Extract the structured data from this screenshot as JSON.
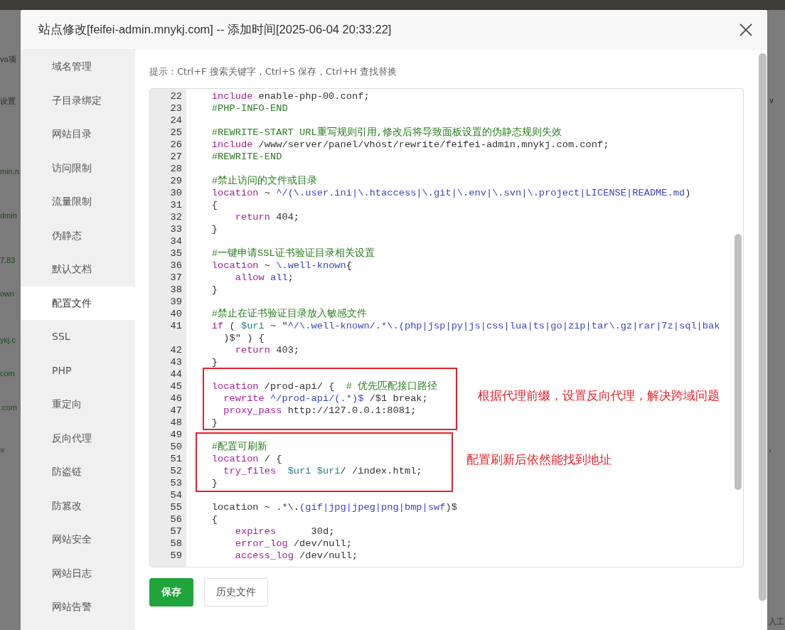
{
  "background_page": {
    "left_fragments": [
      {
        "text": "va项",
        "kind": "plain"
      },
      {
        "text": "设置",
        "kind": "plain"
      },
      {
        "text": "min.n",
        "kind": "link"
      },
      {
        "text": "dmin",
        "kind": "link"
      },
      {
        "text": "7.83",
        "kind": "link"
      },
      {
        "text": "own",
        "kind": "link"
      },
      {
        "text": "ykj.c",
        "kind": "link"
      },
      {
        "text": "com",
        "kind": "link"
      },
      {
        "text": ".com",
        "kind": "link"
      },
      {
        "text": "≡",
        "kind": "plain"
      }
    ],
    "right_fragments": [
      {
        "text": "∨"
      },
      {
        "text": "›"
      },
      {
        "text": "入工"
      }
    ]
  },
  "dialog": {
    "title": "站点修改[feifei-admin.mnykj.com] -- 添加时间[2025-06-04 20:33:22]"
  },
  "sidebar": {
    "items": [
      {
        "label": "域名管理",
        "selected": false
      },
      {
        "label": "子目录绑定",
        "selected": false
      },
      {
        "label": "网站目录",
        "selected": false
      },
      {
        "label": "访问限制",
        "selected": false
      },
      {
        "label": "流量限制",
        "selected": false
      },
      {
        "label": "伪静态",
        "selected": false
      },
      {
        "label": "默认文档",
        "selected": false
      },
      {
        "label": "配置文件",
        "selected": true
      },
      {
        "label": "SSL",
        "selected": false
      },
      {
        "label": "PHP",
        "selected": false
      },
      {
        "label": "重定向",
        "selected": false
      },
      {
        "label": "反向代理",
        "selected": false
      },
      {
        "label": "防盗链",
        "selected": false
      },
      {
        "label": "防篡改",
        "selected": false
      },
      {
        "label": "网站安全",
        "selected": false
      },
      {
        "label": "网站日志",
        "selected": false
      },
      {
        "label": "网站告警",
        "selected": false
      }
    ]
  },
  "hint": "提示：Ctrl+F 搜索关键字，Ctrl+S 保存，Ctrl+H 查找替换",
  "editor": {
    "lines": [
      {
        "number": "22",
        "kind": "block",
        "segments": [
          {
            "kind": "keyword",
            "t": "include"
          },
          {
            "kind": "plain",
            "t": " enable-php-00.conf;"
          }
        ]
      },
      {
        "number": "23",
        "kind": "block",
        "segments": [
          {
            "kind": "comment",
            "t": "#PHP-INFO-END"
          }
        ]
      },
      {
        "number": "24",
        "kind": "block"
      },
      {
        "number": "25",
        "kind": "block",
        "segments": [
          {
            "kind": "comment",
            "t": "#REWRITE-START URL重写规则引用,修改后将导致面板设置的伪静态规则失效"
          }
        ]
      },
      {
        "number": "26",
        "kind": "block",
        "segments": [
          {
            "kind": "keyword",
            "t": "include"
          },
          {
            "kind": "plain",
            "t": " /www/server/panel/vhost/rewrite/feifei-admin.mnykj.com.conf;"
          }
        ]
      },
      {
        "number": "27",
        "kind": "block",
        "segments": [
          {
            "kind": "comment",
            "t": "#REWRITE-END"
          }
        ]
      },
      {
        "number": "28",
        "kind": "block"
      },
      {
        "number": "29",
        "kind": "block",
        "segments": [
          {
            "kind": "comment",
            "t": "#禁止访问的文件或目录"
          }
        ]
      },
      {
        "number": "30",
        "kind": "block",
        "segments": [
          {
            "kind": "keyword",
            "t": "location"
          },
          {
            "kind": "plain",
            "t": " ~ "
          },
          {
            "kind": "regex",
            "t": "^/(\\.user.ini|\\.htaccess|\\.git|\\.env|\\.svn|\\.project|LICENSE|README.md"
          },
          {
            "kind": "plain",
            "t": ")"
          }
        ]
      },
      {
        "number": "31",
        "kind": "block",
        "segments": [
          {
            "kind": "plain",
            "t": "{"
          }
        ]
      },
      {
        "number": "32",
        "kind": "inner",
        "segments": [
          {
            "kind": "keyword",
            "t": "return"
          },
          {
            "kind": "plain",
            "t": " 404;"
          }
        ]
      },
      {
        "number": "33",
        "kind": "block",
        "segments": [
          {
            "kind": "plain",
            "t": "}"
          }
        ]
      },
      {
        "number": "34",
        "kind": "block"
      },
      {
        "number": "35",
        "kind": "block",
        "segments": [
          {
            "kind": "comment",
            "t": "#一键申请SSL证书验证目录相关设置"
          }
        ]
      },
      {
        "number": "36",
        "kind": "block",
        "segments": [
          {
            "kind": "keyword",
            "t": "location"
          },
          {
            "kind": "plain",
            "t": " ~ "
          },
          {
            "kind": "regex",
            "t": "\\.well-known"
          },
          {
            "kind": "plain",
            "t": "{"
          }
        ]
      },
      {
        "number": "37",
        "kind": "inner",
        "segments": [
          {
            "kind": "keyword",
            "t": "allow"
          },
          {
            "kind": "regex",
            "t": " all"
          },
          {
            "kind": "plain",
            "t": ";"
          }
        ]
      },
      {
        "number": "38",
        "kind": "block",
        "segments": [
          {
            "kind": "plain",
            "t": "}"
          }
        ]
      },
      {
        "number": "39",
        "kind": "block"
      },
      {
        "number": "40",
        "kind": "block",
        "segments": [
          {
            "kind": "comment",
            "t": "#禁止在证书验证目录放入敏感文件"
          }
        ]
      },
      {
        "number": "41",
        "kind": "block",
        "segments": [
          {
            "kind": "keyword",
            "t": "if"
          },
          {
            "kind": "plain",
            "t": " ( "
          },
          {
            "kind": "variable",
            "t": "$uri"
          },
          {
            "kind": "plain",
            "t": " ~ \""
          },
          {
            "kind": "regex",
            "t": "^/\\.well-known/.*\\.(php|jsp|py|js|css|lua|ts|go|zip|tar\\.gz|rar|7z|sql|bak"
          }
        ]
      },
      {
        "kind": "continuation",
        "segments": [
          {
            "kind": "plain",
            "t": ")$\" ) {"
          }
        ]
      },
      {
        "number": "42",
        "kind": "inner",
        "segments": [
          {
            "kind": "keyword",
            "t": "return"
          },
          {
            "kind": "plain",
            "t": " 403;"
          }
        ]
      },
      {
        "number": "43",
        "kind": "block",
        "segments": [
          {
            "kind": "plain",
            "t": "}"
          }
        ]
      },
      {
        "number": "44",
        "kind": "block"
      },
      {
        "number": "45",
        "kind": "block",
        "segments": [
          {
            "kind": "keyword",
            "t": "location"
          },
          {
            "kind": "plain",
            "t": " /prod-api/ {  "
          },
          {
            "kind": "comment",
            "t": "# 优先匹配接口路径"
          }
        ]
      },
      {
        "number": "46",
        "kind": "half",
        "segments": [
          {
            "kind": "keyword",
            "t": "rewrite"
          },
          {
            "kind": "regex",
            "t": " ^/prod-api/(.*)$"
          },
          {
            "kind": "plain",
            "t": " /$1 break;"
          }
        ]
      },
      {
        "number": "47",
        "kind": "half",
        "segments": [
          {
            "kind": "keyword",
            "t": "proxy_pass"
          },
          {
            "kind": "plain",
            "t": " http://127.0.0.1:8081;"
          }
        ]
      },
      {
        "number": "48",
        "kind": "block",
        "segments": [
          {
            "kind": "plain",
            "t": "}"
          }
        ]
      },
      {
        "number": "49",
        "kind": "block"
      },
      {
        "number": "50",
        "kind": "block",
        "segments": [
          {
            "kind": "comment",
            "t": "#配置可刷新"
          }
        ]
      },
      {
        "number": "51",
        "kind": "block",
        "segments": [
          {
            "kind": "keyword",
            "t": "location"
          },
          {
            "kind": "plain",
            "t": " / {"
          }
        ]
      },
      {
        "number": "52",
        "kind": "half",
        "segments": [
          {
            "kind": "keyword",
            "t": "try_files"
          },
          {
            "kind": "variable",
            "t": "  $uri"
          },
          {
            "kind": "variable",
            "t": " $uri"
          },
          {
            "kind": "plain",
            "t": "/ /index.html;"
          }
        ]
      },
      {
        "number": "53",
        "kind": "block",
        "segments": [
          {
            "kind": "plain",
            "t": "}"
          }
        ]
      },
      {
        "number": "54",
        "kind": "block"
      },
      {
        "number": "55",
        "kind": "block",
        "segments": [
          {
            "kind": "plain",
            "t": "location ~ .*\\."
          },
          {
            "kind": "regex",
            "t": "(gif|jpg|jpeg|png|bmp|swf"
          },
          {
            "kind": "plain",
            "t": ")$"
          }
        ]
      },
      {
        "number": "56",
        "kind": "block",
        "segments": [
          {
            "kind": "plain",
            "t": "{"
          }
        ]
      },
      {
        "number": "57",
        "kind": "inner",
        "segments": [
          {
            "kind": "keyword",
            "t": "expires"
          },
          {
            "kind": "plain",
            "t": "      30d;"
          }
        ]
      },
      {
        "number": "58",
        "kind": "inner",
        "segments": [
          {
            "kind": "keyword",
            "t": "error_log"
          },
          {
            "kind": "plain",
            "t": " /dev/null;"
          }
        ]
      },
      {
        "number": "59",
        "kind": "inner",
        "segments": [
          {
            "kind": "keyword",
            "t": "access_log"
          },
          {
            "kind": "plain",
            "t": " /dev/null;"
          }
        ]
      }
    ]
  },
  "annotations": [
    {
      "text": "根据代理前缀，设置反向代理，解决跨域问题"
    },
    {
      "text": "配置刷新后依然能找到地址"
    }
  ],
  "buttons": [
    {
      "label": "保存",
      "kind": "primary"
    },
    {
      "label": "历史文件",
      "kind": "secondary"
    }
  ]
}
